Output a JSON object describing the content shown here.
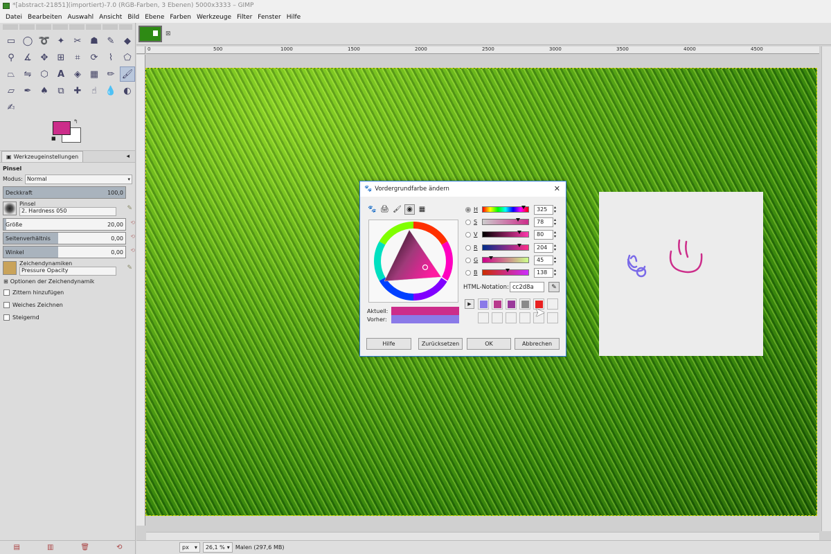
{
  "window": {
    "title": "*[abstract-21851](importiert)-7.0 (RGB-Farben, 3 Ebenen) 5000x3333 – GIMP"
  },
  "menu": [
    "Datei",
    "Bearbeiten",
    "Auswahl",
    "Ansicht",
    "Bild",
    "Ebene",
    "Farben",
    "Werkzeuge",
    "Filter",
    "Fenster",
    "Hilfe"
  ],
  "colors": {
    "foreground": "#cc2d8a",
    "background": "#ffffff",
    "previous": "#8a7ae8"
  },
  "tool_options": {
    "tab_label": "Werkzeugeinstellungen",
    "tool_name": "Pinsel",
    "mode_label": "Modus:",
    "mode_value": "Normal",
    "opacity": {
      "label": "Deckkraft",
      "value": "100,0"
    },
    "brush": {
      "label": "Pinsel",
      "value": "2. Hardness 050"
    },
    "size": {
      "label": "Größe",
      "value": "20,00"
    },
    "aspect": {
      "label": "Seitenverhältnis",
      "value": "0,00"
    },
    "angle": {
      "label": "Winkel",
      "value": "0,00"
    },
    "dynamics": {
      "label": "Zeichendynamiken",
      "value": "Pressure Opacity"
    },
    "dynamics_options": "Optionen der Zeichendynamik",
    "jitter": "Zittern hinzufügen",
    "smooth": "Weiches Zeichnen",
    "incremental": "Steigernd"
  },
  "ruler_ticks": [
    "0",
    "500",
    "1000",
    "1500",
    "2000",
    "2500",
    "3000",
    "3500",
    "4000",
    "4500"
  ],
  "statusbar": {
    "unit": "px",
    "zoom": "26,1 %",
    "message": "Malen (297,6 MB)"
  },
  "dialog": {
    "title": "Vordergrundfarbe ändern",
    "channels": [
      {
        "name": "H",
        "value": "325",
        "fraction": 0.9
      },
      {
        "name": "S",
        "value": "78",
        "fraction": 0.78
      },
      {
        "name": "V",
        "value": "80",
        "fraction": 0.8
      },
      {
        "name": "R",
        "value": "204",
        "fraction": 0.8
      },
      {
        "name": "G",
        "value": "45",
        "fraction": 0.18
      },
      {
        "name": "B",
        "value": "138",
        "fraction": 0.54
      }
    ],
    "html_label": "HTML-Notation:",
    "html_value": "cc2d8a",
    "current_label": "Aktuell:",
    "previous_label": "Vorher:",
    "history": [
      "#8a7ae8",
      "#b83a8c",
      "#9a3a9a",
      "#8a8a8a",
      "#e82020"
    ],
    "buttons": {
      "help": "Hilfe",
      "reset": "Zurücksetzen",
      "ok": "OK",
      "cancel": "Abbrechen"
    }
  }
}
